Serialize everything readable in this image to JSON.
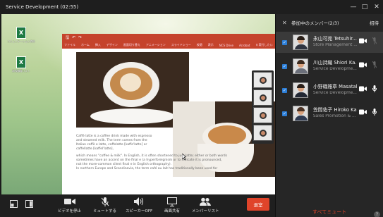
{
  "window": {
    "title": "Service Development (02:55)",
    "controls": [
      "—",
      "□",
      "✕"
    ]
  },
  "desktop": {
    "icons": [
      {
        "label": "コミュニケーション資料"
      },
      {
        "label": "新規顧客リスト"
      }
    ]
  },
  "presentation": {
    "ribbon_tabs": [
      "ファイル",
      "ホーム",
      "挿入",
      "デザイン",
      "画面切り替え",
      "アニメーション",
      "スライドショー",
      "校閲",
      "表示",
      "NCS Drive",
      "Acrobat",
      "♀ 実行したい"
    ],
    "slide_text": [
      "Caffè latte is a coffee drink made with espresso",
      "and steamed milk. The term comes from the",
      "Italian caffè e latte, caffelatte [kaffe'latte] or",
      "caffellatte [kaffel'latte],",
      "which means \"coffee & milk\". In English, it is often shortened to just latte; either or both words",
      "sometimes have an accent on the final e (a hyperforeignism or to indicate it is pronounced,",
      "not the more-common silent final e in English orthography).",
      "",
      "In northern Europe and Scandinavia, the term café au lait has traditionally been used for"
    ]
  },
  "controls": {
    "video": {
      "label": "ビデオを停止",
      "icon": "video-camera-icon"
    },
    "mute": {
      "label": "ミュートする",
      "icon": "microphone-off-icon"
    },
    "speaker": {
      "label": "スピーカーOFF",
      "icon": "speaker-icon"
    },
    "share": {
      "label": "画面共有",
      "icon": "monitor-icon"
    },
    "members": {
      "label": "メンバーリスト",
      "icon": "people-icon"
    },
    "exit_label": "退室"
  },
  "panel": {
    "title": "参加中のメンバー(2/3)",
    "invite_label": "招待",
    "mute_all_label": "すべてミュート",
    "help_label": "?",
    "participants": [
      {
        "name": "永山可苑 Tetsuhir...",
        "dept": "Store Management ...",
        "mic": "off"
      },
      {
        "name": "川山詩織 Shiori Ka...",
        "dept": "Service Developme...",
        "mic": "off"
      },
      {
        "name": "小野磯雅章 Masatak...",
        "dept": "Service Developme...",
        "mic": "on"
      },
      {
        "name": "笠間佑子 Hiroko Kas...",
        "dept": "Sales Promotion & ...",
        "mic": "on"
      }
    ]
  },
  "colors": {
    "accent_blue": "#2d7fd8",
    "exit_red": "#e0442a",
    "ppt_red": "#c5432c"
  }
}
